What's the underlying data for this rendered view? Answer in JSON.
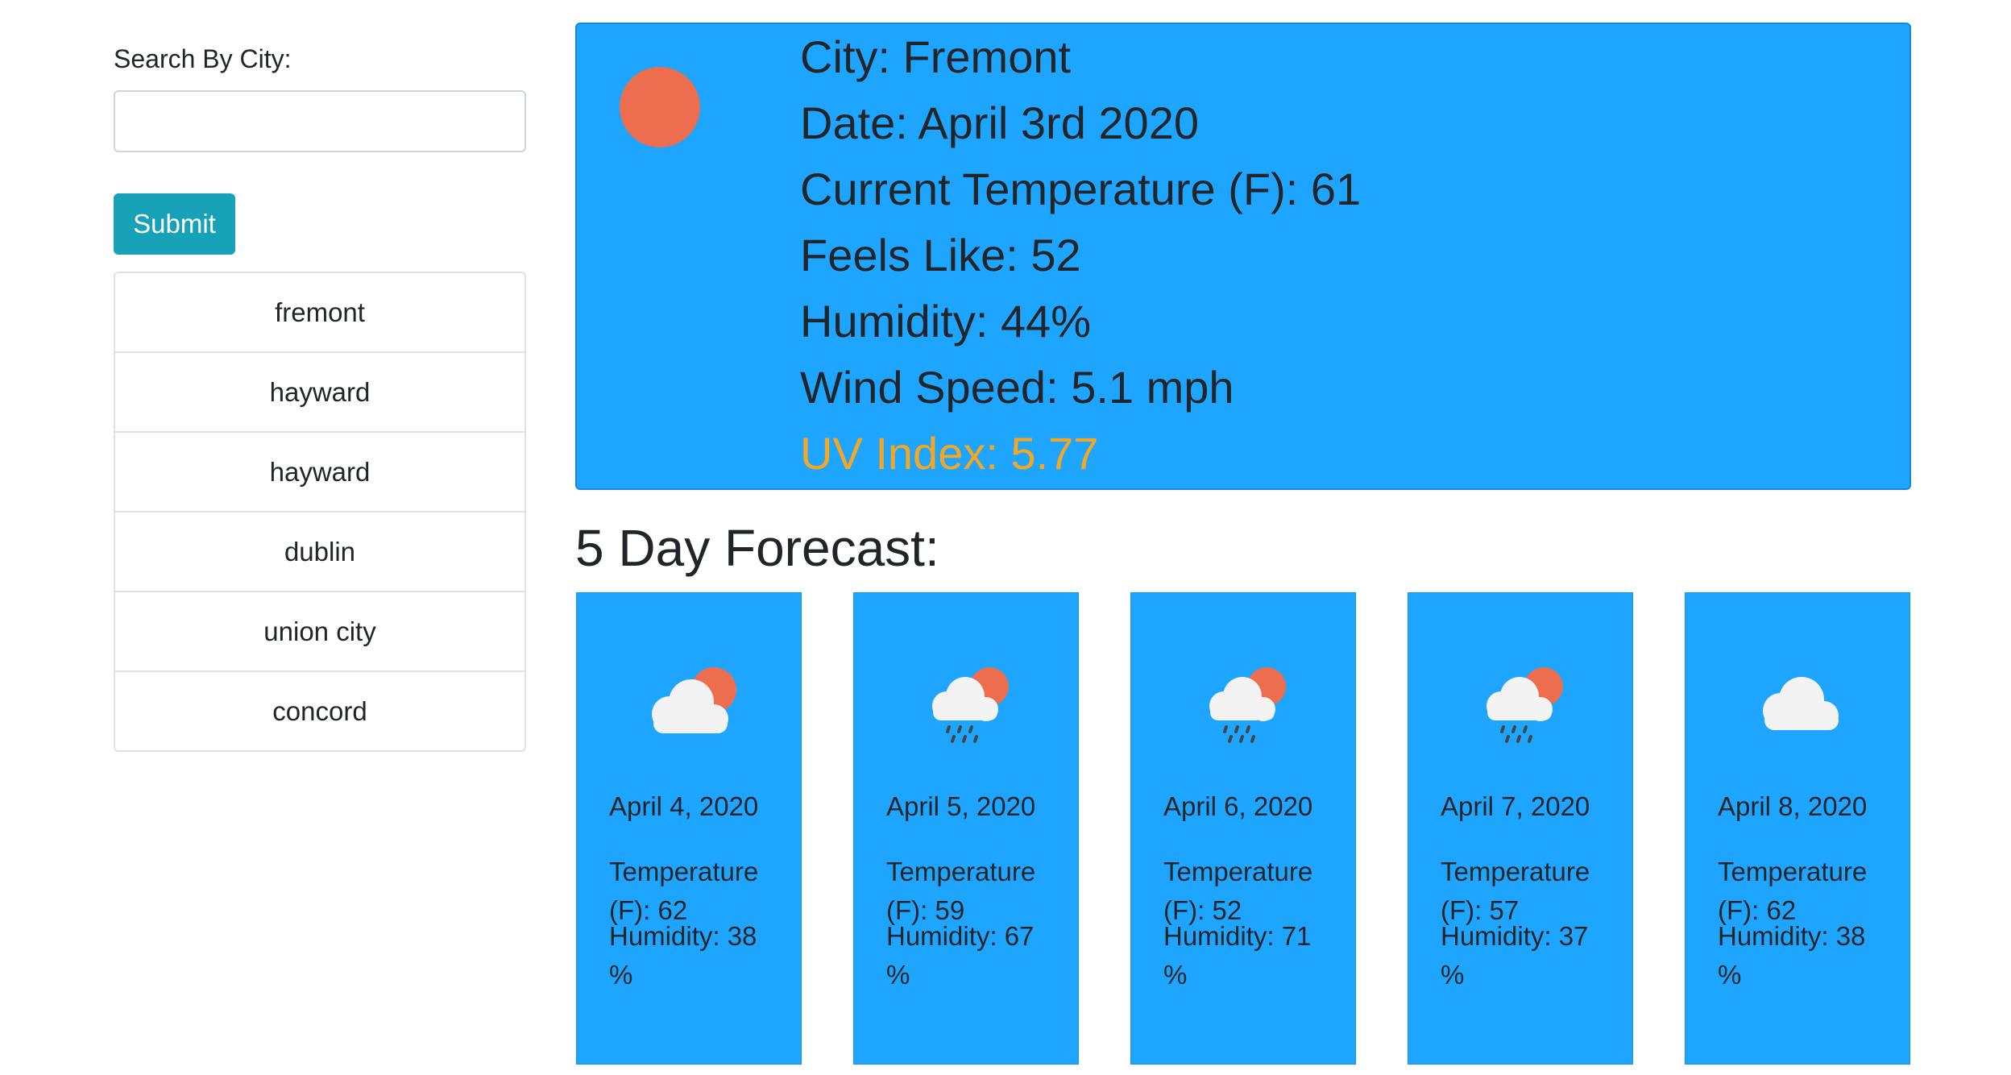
{
  "search": {
    "label": "Search By City:",
    "input_value": "",
    "placeholder": "",
    "submit_label": "Submit"
  },
  "history": [
    "fremont",
    "hayward",
    "hayward",
    "dublin",
    "union city",
    "concord"
  ],
  "current": {
    "icon": "sun-icon",
    "city": "City: Fremont",
    "date": "Date: April 3rd 2020",
    "temperature": "Current Temperature (F): 61",
    "feels_like": "Feels Like: 52",
    "humidity": "Humidity: 44%",
    "wind": "Wind Speed: 5.1 mph",
    "uv": "UV Index: 5.77"
  },
  "forecast": {
    "title": "5 Day Forecast:",
    "days": [
      {
        "icon": "cloud-sun-icon",
        "date": "April 4, 2020",
        "temp": "Temperature (F): 62",
        "humidity": "Humidity: 38 %"
      },
      {
        "icon": "rain-sun-icon",
        "date": "April 5, 2020",
        "temp": "Temperature (F): 59",
        "humidity": "Humidity: 67 %"
      },
      {
        "icon": "rain-sun-icon",
        "date": "April 6, 2020",
        "temp": "Temperature (F): 52",
        "humidity": "Humidity: 71 %"
      },
      {
        "icon": "rain-sun-icon",
        "date": "April 7, 2020",
        "temp": "Temperature (F): 57",
        "humidity": "Humidity: 37 %"
      },
      {
        "icon": "cloud-icon",
        "date": "April 8, 2020",
        "temp": "Temperature (F): 62",
        "humidity": "Humidity: 38 %"
      }
    ]
  },
  "colors": {
    "panel": "#1da5ff",
    "sun": "#ec6e4f",
    "uv_text": "#f5a623",
    "submit": "#17a2b8"
  }
}
